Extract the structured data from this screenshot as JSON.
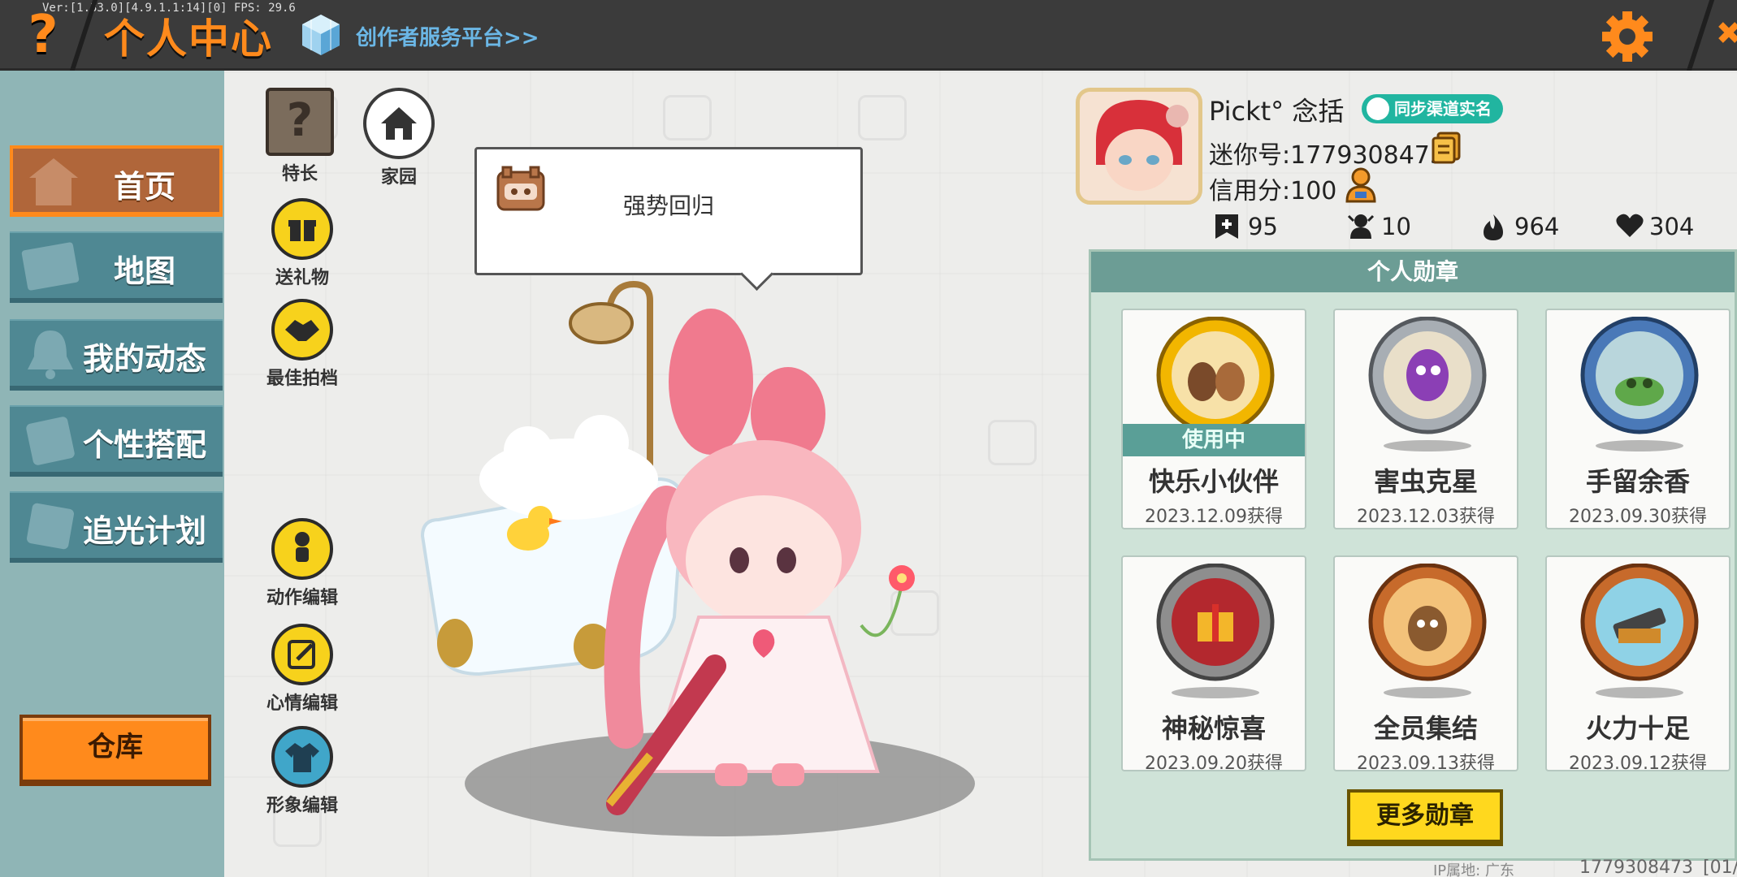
{
  "header": {
    "version": "Ver:[1.33.0][4.9.1.1:14][0] FPS: 29.6",
    "help_icon": "question-mark-icon",
    "title": "个人中心",
    "creator_link": "创作者服务平台>>",
    "settings_icon": "gear-icon"
  },
  "sidebar": {
    "items": [
      {
        "label": "首页",
        "icon": "home-icon",
        "active": true
      },
      {
        "label": "地图",
        "icon": "map-icon",
        "active": false
      },
      {
        "label": "我的动态",
        "icon": "bell-icon",
        "active": false
      },
      {
        "label": "个性搭配",
        "icon": "outfit-icon",
        "active": false
      },
      {
        "label": "追光计划",
        "icon": "light-icon",
        "active": false
      }
    ],
    "warehouse": "仓库"
  },
  "tools": {
    "specialty": "特长",
    "home": "家园",
    "gift": "送礼物",
    "partner": "最佳拍档",
    "action_edit": "动作编辑",
    "mood_edit": "心情编辑",
    "image_edit": "形象编辑"
  },
  "speech": {
    "text": "强势回归"
  },
  "profile": {
    "name": "Pickt°  念括",
    "sync_badge": "同步渠道实名",
    "mini_id": "迷你号:1779308473",
    "credit": "信用分:100",
    "stats": [
      {
        "icon": "plus-icon",
        "value": "95"
      },
      {
        "icon": "fans-icon",
        "value": "10"
      },
      {
        "icon": "flame-icon",
        "value": "964"
      },
      {
        "icon": "heart-icon",
        "value": "304"
      }
    ]
  },
  "medals": {
    "header": "个人勋章",
    "in_use_label": "使用中",
    "items": [
      {
        "name": "快乐小伙伴",
        "date": "2023.12.09获得",
        "in_use": true,
        "color": "#f2b600"
      },
      {
        "name": "害虫克星",
        "date": "2023.12.03获得",
        "in_use": false,
        "color": "#9aa0a6"
      },
      {
        "name": "手留余香",
        "date": "2023.09.30获得",
        "in_use": false,
        "color": "#4a79b8"
      },
      {
        "name": "神秘惊喜",
        "date": "2023.09.20获得",
        "in_use": false,
        "color": "#8e8e8e"
      },
      {
        "name": "全员集结",
        "date": "2023.09.13获得",
        "in_use": false,
        "color": "#c76a2b"
      },
      {
        "name": "火力十足",
        "date": "2023.09.12获得",
        "in_use": false,
        "color": "#c76a2b"
      }
    ],
    "more_button": "更多勋章"
  },
  "footer": {
    "ip": "IP属地: 广东",
    "id": "1779308473",
    "page": "[01/"
  },
  "colors": {
    "accent_orange": "#ff8a1c",
    "teal": "#4f8893",
    "medal_panel": "#cfe3d8",
    "yellow_button": "#ffd81e"
  }
}
